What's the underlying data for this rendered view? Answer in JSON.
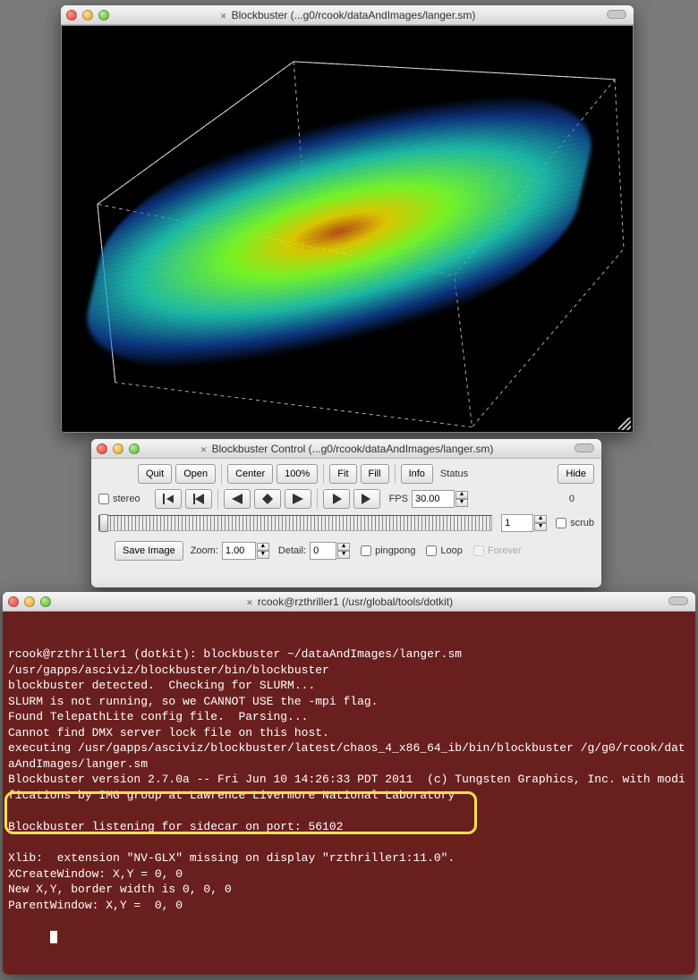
{
  "viewer": {
    "title": "Blockbuster (...g0/rcook/dataAndImages/langer.sm)"
  },
  "control": {
    "title": "Blockbuster Control (...g0/rcook/dataAndImages/langer.sm)",
    "toolbar": {
      "quit": "Quit",
      "open": "Open",
      "center": "Center",
      "p100": "100%",
      "fit": "Fit",
      "fill": "Fill",
      "info": "Info",
      "status": "Status",
      "hide": "Hide"
    },
    "playback": {
      "stereo": "stereo",
      "fps_label": "FPS",
      "fps_value": "30.00",
      "frame_count": "0",
      "frame_value": "1",
      "scrub": "scrub"
    },
    "bottom": {
      "save": "Save Image",
      "zoom_label": "Zoom:",
      "zoom_value": "1.00",
      "detail_label": "Detail:",
      "detail_value": "0",
      "pingpong": "pingpong",
      "loop": "Loop",
      "forever": "Forever"
    }
  },
  "terminal": {
    "title": "rcook@rzthriller1 (/usr/global/tools/dotkit)",
    "lines": [
      "rcook@rzthriller1 (dotkit): blockbuster ~/dataAndImages/langer.sm",
      "/usr/gapps/asciviz/blockbuster/bin/blockbuster",
      "blockbuster detected.  Checking for SLURM...",
      "SLURM is not running, so we CANNOT USE the -mpi flag.",
      "Found TelepathLite config file.  Parsing...",
      "Cannot find DMX server lock file on this host.",
      "executing /usr/gapps/asciviz/blockbuster/latest/chaos_4_x86_64_ib/bin/blockbuster /g/g0/rcook/dataAndImages/langer.sm",
      "Blockbuster version 2.7.0a -- Fri Jun 10 14:26:33 PDT 2011  (c) Tungsten Graphics, Inc. with modifications by IMG group at Lawrence Livermore National Laboratory",
      "",
      "Blockbuster listening for sidecar on port: 56102",
      "",
      "Xlib:  extension \"NV-GLX\" missing on display \"rzthriller1:11.0\".",
      "XCreateWindow: X,Y = 0, 0",
      "New X,Y, border width is 0, 0, 0",
      "ParentWindow: X,Y =  0, 0"
    ]
  }
}
